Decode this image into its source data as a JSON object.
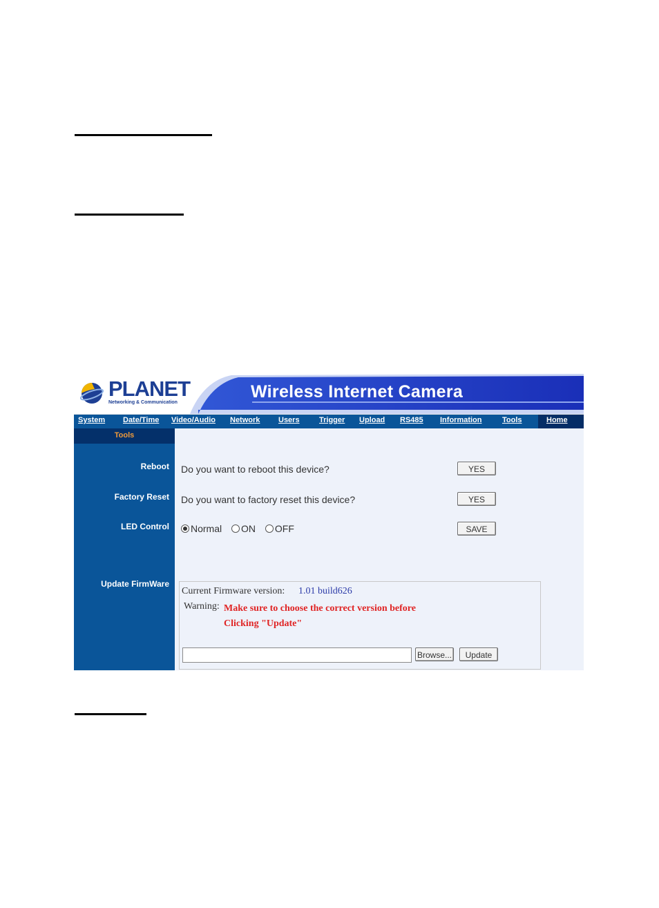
{
  "header": {
    "logo_text": "PLANET",
    "logo_subtitle": "Networking & Communication",
    "banner_title": "Wireless Internet Camera"
  },
  "nav": {
    "items": [
      "System",
      "Date/Time",
      "Video/Audio",
      "Network",
      "Users",
      "Trigger",
      "Upload",
      "RS485",
      "Information",
      "Tools"
    ],
    "home": "Home"
  },
  "sidebar": {
    "section": "Tools",
    "reboot": "Reboot",
    "factory_reset": "Factory Reset",
    "led_control": "LED Control",
    "update_firmware": "Update FirmWare"
  },
  "reboot": {
    "question": "Do you want to reboot this device?",
    "button": "YES"
  },
  "factory_reset": {
    "question": "Do you want to factory reset this device?",
    "button": "YES"
  },
  "led": {
    "options": [
      "Normal",
      "ON",
      "OFF"
    ],
    "selected": "Normal",
    "save_button": "SAVE"
  },
  "firmware": {
    "version_label": "Current Firmware version:",
    "version_value": "1.01 build626",
    "warning_label": "Warning:",
    "warning_line1": "Make sure to choose the correct version before",
    "warning_line2": "Clicking \"Update\"",
    "file_value": "",
    "browse_button": "Browse...",
    "update_button": "Update"
  },
  "colors": {
    "nav_blue": "#0a5599",
    "dark_blue": "#04306a",
    "content_bg": "#eef2fa",
    "warning_red": "#e02424",
    "version_blue": "#2b3aa8",
    "tools_orange": "#f09a3a"
  }
}
